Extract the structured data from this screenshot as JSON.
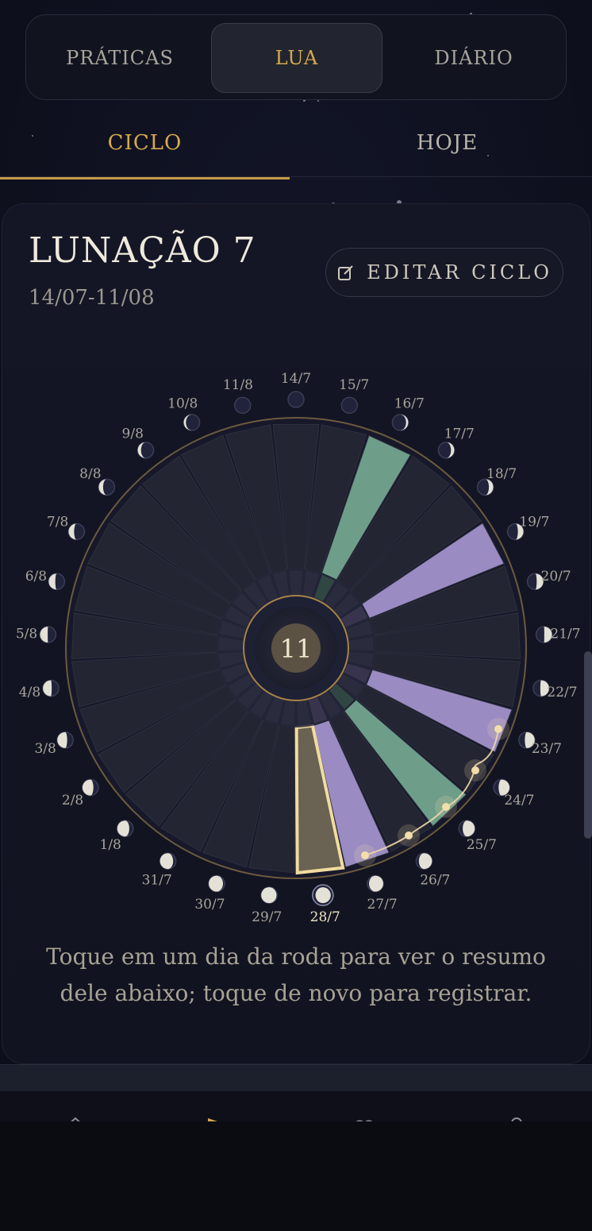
{
  "main_tabs": [
    {
      "label": "PRÁTICAS",
      "active": false
    },
    {
      "label": "LUA",
      "active": true
    },
    {
      "label": "DIÁRIO",
      "active": false
    }
  ],
  "sub_tabs": [
    {
      "label": "CICLO",
      "active": true
    },
    {
      "label": "HOJE",
      "active": false
    }
  ],
  "lunation": {
    "title": "LUNAÇÃO 7",
    "dates": "14/07-11/08",
    "edit_label": "EDITAR CICLO",
    "edit_icon": "edit-icon"
  },
  "wheel": {
    "center_day": "11",
    "selected_day": "28/7",
    "days": [
      "14/7",
      "15/7",
      "16/7",
      "17/7",
      "18/7",
      "19/7",
      "20/7",
      "21/7",
      "22/7",
      "23/7",
      "24/7",
      "25/7",
      "26/7",
      "27/7",
      "28/7",
      "29/7",
      "30/7",
      "31/7",
      "1/8",
      "2/8",
      "3/8",
      "4/8",
      "5/8",
      "6/8",
      "7/8",
      "8/8",
      "9/8",
      "10/8",
      "11/8"
    ],
    "segment_states": [
      "empty",
      "empty",
      "green",
      "empty",
      "empty",
      "purple",
      "empty",
      "empty",
      "empty",
      "purple",
      "empty",
      "green",
      "empty",
      "purple",
      "selected",
      "empty",
      "empty",
      "empty",
      "empty",
      "empty",
      "empty",
      "empty",
      "empty",
      "empty",
      "empty",
      "empty",
      "empty",
      "empty",
      "empty"
    ],
    "colors": {
      "green": "#6e9e8a",
      "purple": "#9a8cc2",
      "selected": "#6a6252",
      "selected_border": "#f0dca0",
      "empty": "#242532",
      "ring": "#8a7450"
    }
  },
  "hint": "Toque em um dia da roda para ver o resumo dele abaixo; toque de novo para registrar."
}
